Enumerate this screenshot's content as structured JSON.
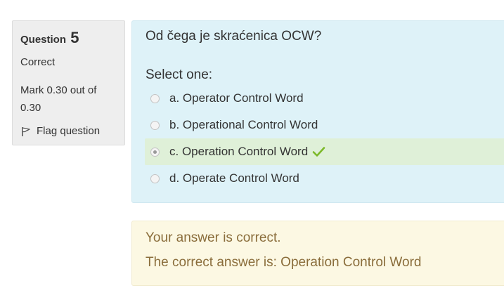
{
  "question_info": {
    "label": "Question",
    "number": "5",
    "state": "Correct",
    "grade": "Mark 0.30 out of 0.30",
    "flag_label": "Flag question",
    "flag_icon": "flag-icon"
  },
  "question": {
    "text": "Od čega je skraćenica OCW?",
    "prompt": "Select one:",
    "answers": [
      {
        "label": "a. Operator Control Word",
        "selected": false,
        "correct": false
      },
      {
        "label": "b. Operational Control Word",
        "selected": false,
        "correct": false
      },
      {
        "label": "c. Operation Control Word",
        "selected": true,
        "correct": true
      },
      {
        "label": "d. Operate Control Word",
        "selected": false,
        "correct": false
      }
    ]
  },
  "outcome": {
    "feedback": "Your answer is correct.",
    "right_answer": "The correct answer is: Operation Control Word"
  },
  "colors": {
    "formulation_bg": "#def2f8",
    "outcome_bg": "#fcf8e3",
    "outcome_text": "#8a6d3b",
    "correct_bg": "#dff0d8",
    "check": "#7cb929"
  }
}
